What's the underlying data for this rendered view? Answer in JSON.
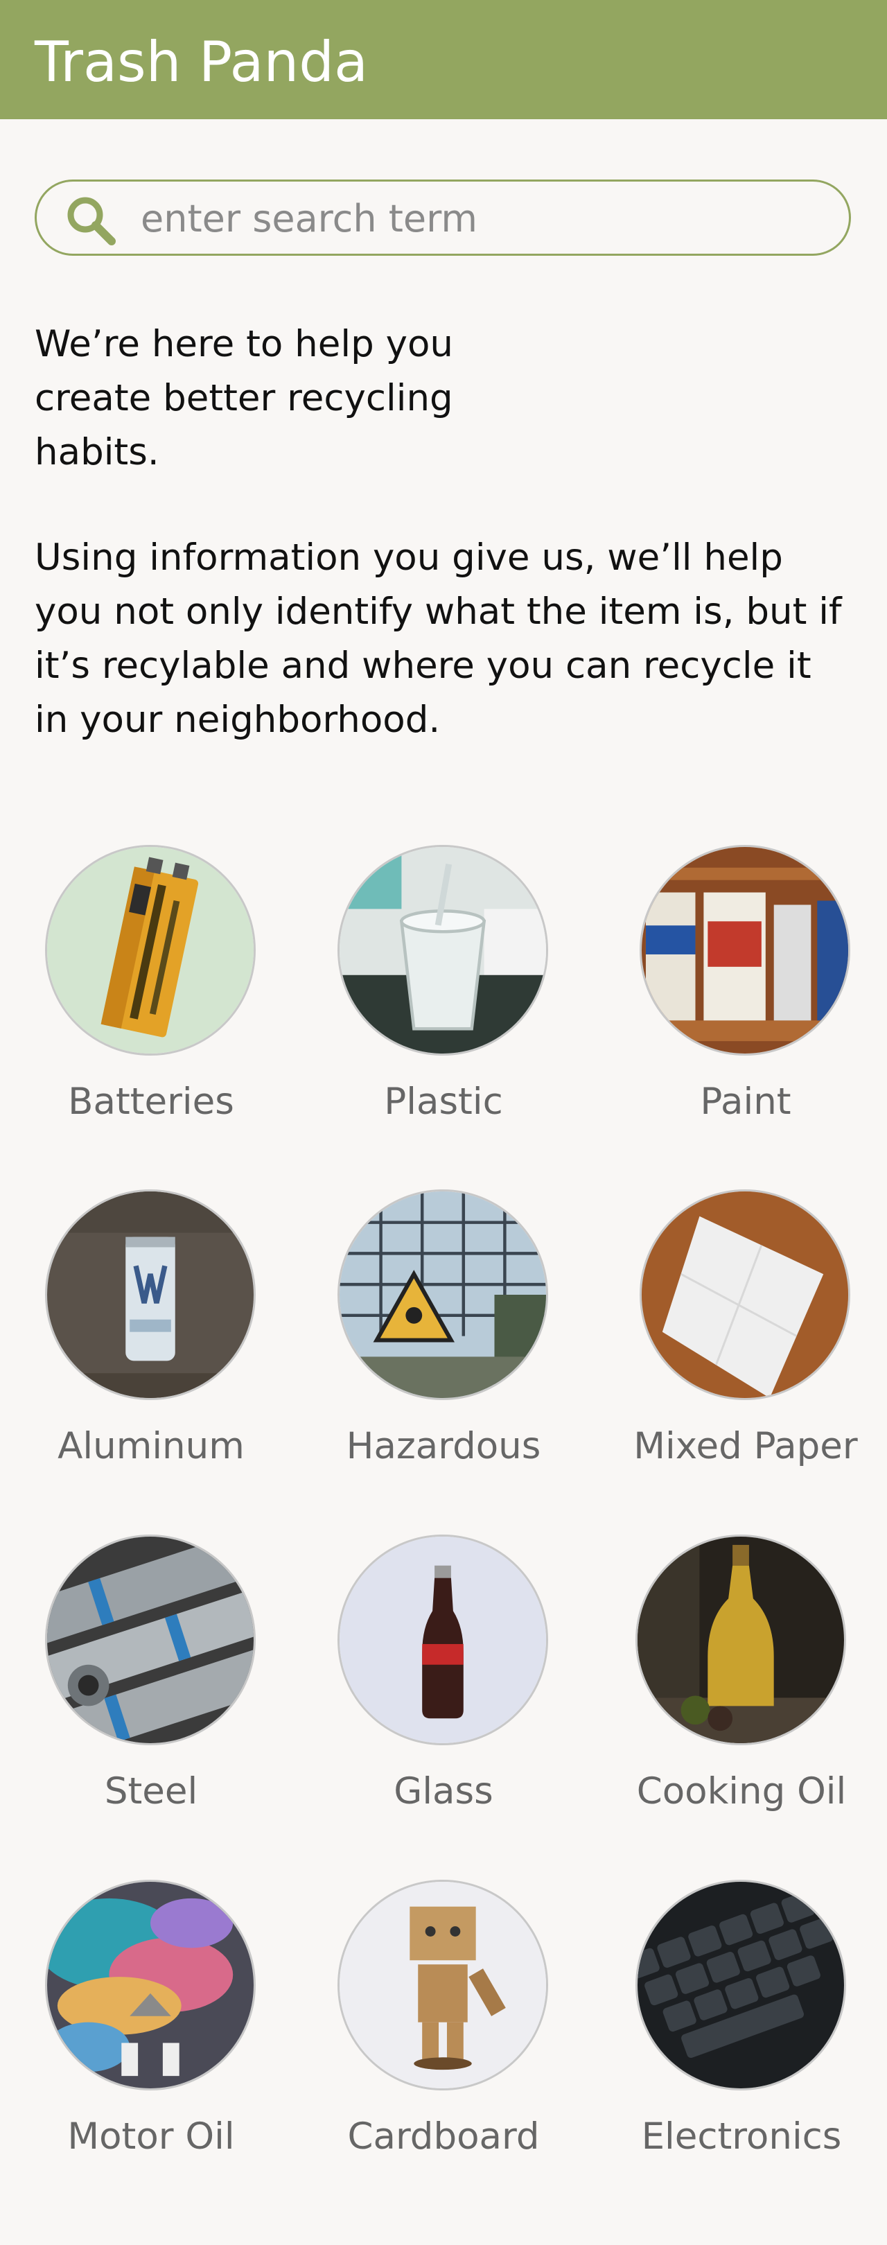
{
  "header": {
    "title": "Trash Panda",
    "background": "#93a660"
  },
  "search": {
    "placeholder": "enter search term",
    "value": "",
    "icon": "search-icon"
  },
  "intro": "We’re here to help you create better recycling habits.",
  "description": "Using information you give us, we’ll help you not only identify what the item is, but if it’s recylable and where you can recycle it in your neighborhood.",
  "categories": [
    {
      "label": "Batteries",
      "icon": "battery-image"
    },
    {
      "label": "Plastic",
      "icon": "plastic-cup-image"
    },
    {
      "label": "Paint",
      "icon": "paint-cans-image"
    },
    {
      "label": "Aluminum",
      "icon": "aluminum-can-image"
    },
    {
      "label": "Hazardous",
      "icon": "hazard-sign-image"
    },
    {
      "label": "Mixed Paper",
      "icon": "paper-sheet-image"
    },
    {
      "label": "Steel",
      "icon": "steel-coils-image"
    },
    {
      "label": "Glass",
      "icon": "glass-bottle-image"
    },
    {
      "label": "Cooking Oil",
      "icon": "oil-bottle-image"
    },
    {
      "label": "Motor Oil",
      "icon": "oil-slick-image"
    },
    {
      "label": "Cardboard",
      "icon": "cardboard-robot-image"
    },
    {
      "label": "Electronics",
      "icon": "keyboard-image"
    }
  ]
}
